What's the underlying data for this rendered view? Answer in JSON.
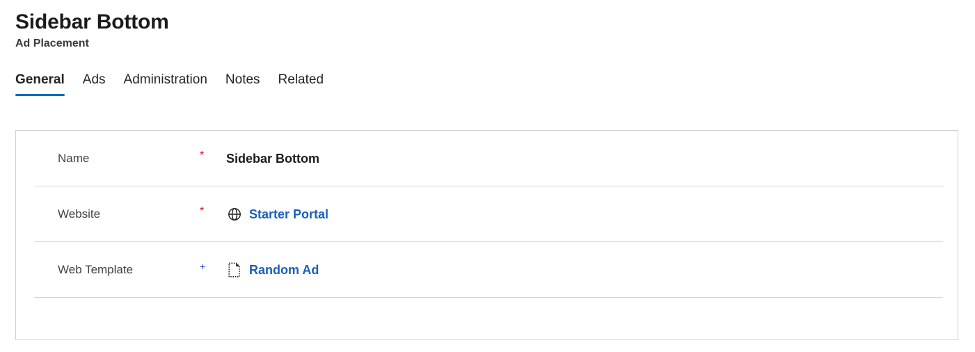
{
  "header": {
    "title": "Sidebar Bottom",
    "subtitle": "Ad Placement"
  },
  "tabs": [
    {
      "label": "General",
      "active": true
    },
    {
      "label": "Ads",
      "active": false
    },
    {
      "label": "Administration",
      "active": false
    },
    {
      "label": "Notes",
      "active": false
    },
    {
      "label": "Related",
      "active": false
    }
  ],
  "form": {
    "fields": [
      {
        "label": "Name",
        "marker": "*",
        "marker_type": "required",
        "value": "Sidebar Bottom",
        "value_type": "text",
        "icon": ""
      },
      {
        "label": "Website",
        "marker": "*",
        "marker_type": "required",
        "value": "Starter Portal",
        "value_type": "link",
        "icon": "globe-icon"
      },
      {
        "label": "Web Template",
        "marker": "+",
        "marker_type": "recommended",
        "value": "Random Ad",
        "value_type": "link",
        "icon": "page-dotted-icon"
      }
    ]
  },
  "colors": {
    "link": "#1a5fbd",
    "accent": "#0f6cbd",
    "required": "#e00b1c",
    "recommended": "#0f35d4",
    "text": "#242424",
    "label": "#424242",
    "border": "#d1d1d1",
    "divider": "#d6d6d6"
  }
}
